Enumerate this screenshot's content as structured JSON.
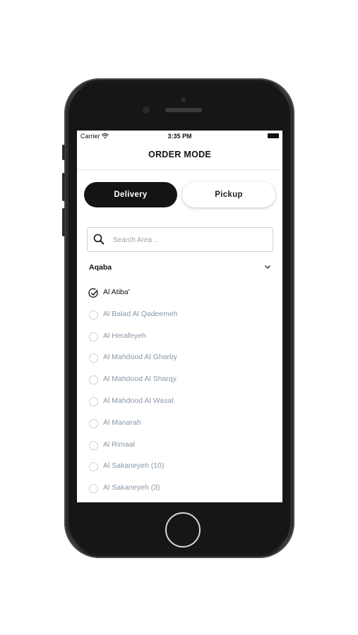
{
  "status_bar": {
    "carrier": "Carrier",
    "time": "3:35 PM"
  },
  "header": {
    "title": "ORDER MODE"
  },
  "order_mode": {
    "delivery_label": "Delivery",
    "pickup_label": "Pickup",
    "selected": "Delivery"
  },
  "search": {
    "placeholder": "Search Area .."
  },
  "region": {
    "name": "Aqaba"
  },
  "areas": [
    {
      "label": "Al Atiba'",
      "selected": true
    },
    {
      "label": "Al Balad Al Qadeemeh",
      "selected": false
    },
    {
      "label": "Al Herafeyeh",
      "selected": false
    },
    {
      "label": "Al Mahdood Al Gharby",
      "selected": false
    },
    {
      "label": "Al Mahdood Al Sharqy",
      "selected": false
    },
    {
      "label": "Al Mahdood Al Wasat",
      "selected": false
    },
    {
      "label": "Al Manarah",
      "selected": false
    },
    {
      "label": "Al Rimaal",
      "selected": false
    },
    {
      "label": "Al Sakaneyeh (10)",
      "selected": false
    },
    {
      "label": "Al Sakaneyeh (3)",
      "selected": false
    }
  ],
  "colors": {
    "accent": "#141414",
    "muted_text": "#8a98a6"
  }
}
